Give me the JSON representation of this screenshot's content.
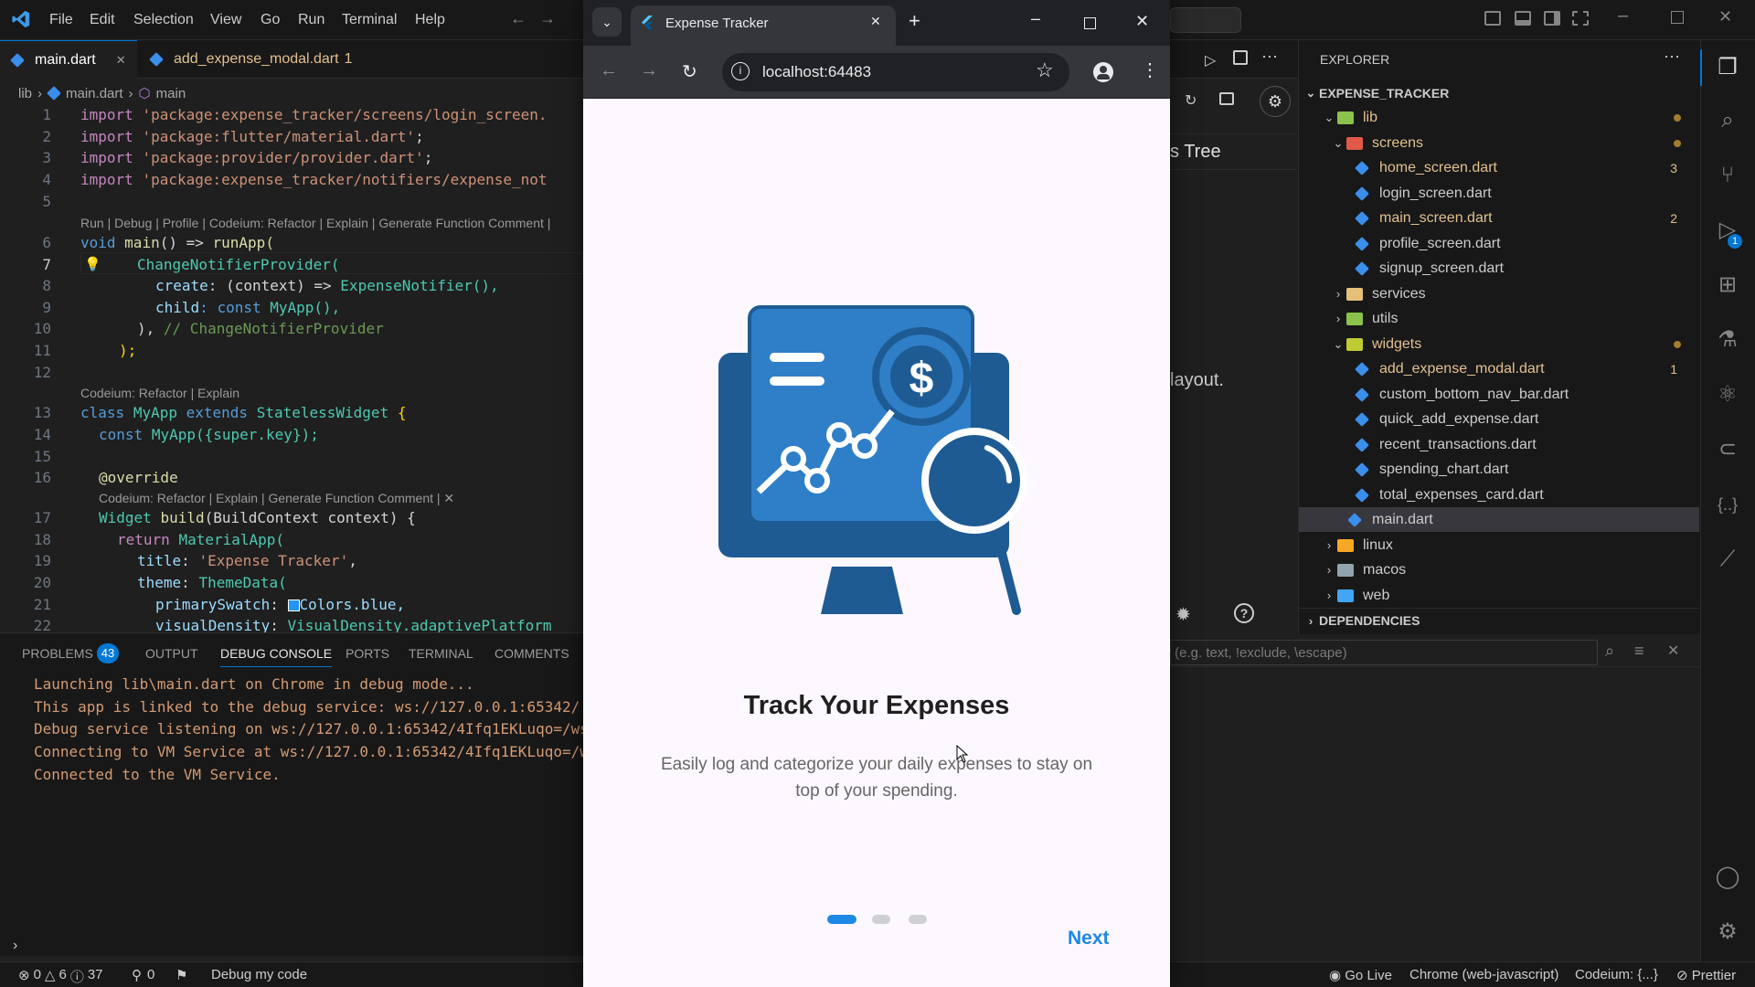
{
  "menu": [
    "File",
    "Edit",
    "Selection",
    "View",
    "Go",
    "Run",
    "Terminal",
    "Help"
  ],
  "editor_tabs": [
    {
      "name": "main.dart",
      "active": true,
      "close": "✕"
    },
    {
      "name": "add_expense_modal.dart",
      "problems": "1"
    }
  ],
  "breadcrumb": {
    "root": "lib",
    "file": "main.dart",
    "symbol": "main"
  },
  "code": {
    "l1": "1",
    "l2": "2",
    "l3": "3",
    "l4": "4",
    "l5": "5",
    "l6": "6",
    "l7": "7",
    "l8": "8",
    "l9": "9",
    "l10": "10",
    "l11": "11",
    "l12": "12",
    "l13": "13",
    "l14": "14",
    "l15": "15",
    "l16": "16",
    "l17": "17",
    "l18": "18",
    "l19": "19",
    "l20": "20",
    "l21": "21",
    "l22": "22",
    "lens1": "Run | Debug | Profile | Codeium: Refactor | Explain | Generate Function Comment |",
    "lens2": "Codeium: Refactor | Explain",
    "lens3": "Codeium: Refactor | Explain | Generate Function Comment | ✕",
    "t_import": "import",
    "s1": "'package:expense_tracker/screens/login_screen.",
    "s2": "'package:flutter/material.dart'",
    "s3": "'package:provider/provider.dart'",
    "s4": "'package:expense_tracker/notifiers/expense_not",
    "semi": ";",
    "t_void": "void",
    "t_main": "main",
    "t_arrow": "() =>",
    "t_runApp": "runApp(",
    "t_cnp": "ChangeNotifierProvider(",
    "t_create": "create",
    "t_ctx": ": (context) =>",
    "t_en": "ExpenseNotifier(),",
    "t_child": "child",
    "t_constmy": ": const",
    "t_myapp": "MyApp(),",
    "t_close1": "),",
    "t_cmt": "// ChangeNotifierProvider",
    "t_close2": ");",
    "t_class": "class",
    "t_myapp2": "MyApp",
    "t_extends": "extends",
    "t_slw": "StatelessWidget",
    "t_brace": "{",
    "t_const": "const",
    "t_myappctor": "MyApp({super.key});",
    "t_override": "@override",
    "t_widget": "Widget",
    "t_build": "build",
    "t_bc": "(BuildContext context) {",
    "t_return": "return",
    "t_matapp": "MaterialApp(",
    "t_title": "title",
    "t_titleval": "'Expense Tracker'",
    "t_theme": "theme",
    "t_themedata": "ThemeData(",
    "t_ps": "primarySwatch",
    "t_colors": "Colors.blue,",
    "t_vd": "visualDensity",
    "t_vdval": "VisualDensity.adaptivePlatform"
  },
  "panel": {
    "tabs": [
      "PROBLEMS",
      "OUTPUT",
      "DEBUG CONSOLE",
      "PORTS",
      "TERMINAL",
      "COMMENTS"
    ],
    "problems_count": "43",
    "lines": [
      "Launching lib\\main.dart on Chrome in debug mode...",
      "This app is linked to the debug service: ws://127.0.0.1:65342/",
      "Debug service listening on ws://127.0.0.1:65342/4Ifq1EKLuqo=/ws",
      "Connecting to VM Service at ws://127.0.0.1:65342/4Ifq1EKLuqo=/w",
      "Connected to the VM Service."
    ],
    "filter_placeholder": "r (e.g. text, !exclude, \\escape)"
  },
  "behind": {
    "tree_label": "s Tree",
    "layout_text": "layout."
  },
  "explorer": {
    "title": "EXPLORER",
    "project": "EXPENSE_TRACKER",
    "items": [
      {
        "name": "lib",
        "type": "folder",
        "open": true
      },
      {
        "name": "screens",
        "type": "folder",
        "open": true
      },
      {
        "name": "home_screen.dart",
        "badge": "3"
      },
      {
        "name": "login_screen.dart"
      },
      {
        "name": "main_screen.dart",
        "badge": "2"
      },
      {
        "name": "profile_screen.dart"
      },
      {
        "name": "signup_screen.dart"
      },
      {
        "name": "services",
        "type": "folder"
      },
      {
        "name": "utils",
        "type": "folder"
      },
      {
        "name": "widgets",
        "type": "folder",
        "open": true
      },
      {
        "name": "add_expense_modal.dart",
        "badge": "1"
      },
      {
        "name": "custom_bottom_nav_bar.dart"
      },
      {
        "name": "quick_add_expense.dart"
      },
      {
        "name": "recent_transactions.dart"
      },
      {
        "name": "spending_chart.dart"
      },
      {
        "name": "total_expenses_card.dart"
      },
      {
        "name": "main.dart"
      },
      {
        "name": "linux",
        "type": "folder"
      },
      {
        "name": "macos",
        "type": "folder"
      },
      {
        "name": "web",
        "type": "folder"
      }
    ],
    "dependencies": "DEPENDENCIES"
  },
  "status": {
    "errors": "0",
    "warnings": "6",
    "info": "37",
    "ports": "0",
    "debug": "Debug my code",
    "golive": "Go Live",
    "chrome": "Chrome (web-javascript)",
    "codeium": "Codeium: {...}",
    "prettier": "Prettier"
  },
  "browser": {
    "tab_title": "Expense Tracker",
    "url": "localhost:64483",
    "heading": "Track Your Expenses",
    "body_line1": "Easily log and categorize your daily expenses to stay on",
    "body_line2": "top of your spending.",
    "next": "Next",
    "page_index": 1,
    "page_count": 3
  },
  "colors": {
    "accent": "#1e88e5",
    "illustration": "#1e5b93",
    "illustration_light": "#2f7ec8"
  }
}
